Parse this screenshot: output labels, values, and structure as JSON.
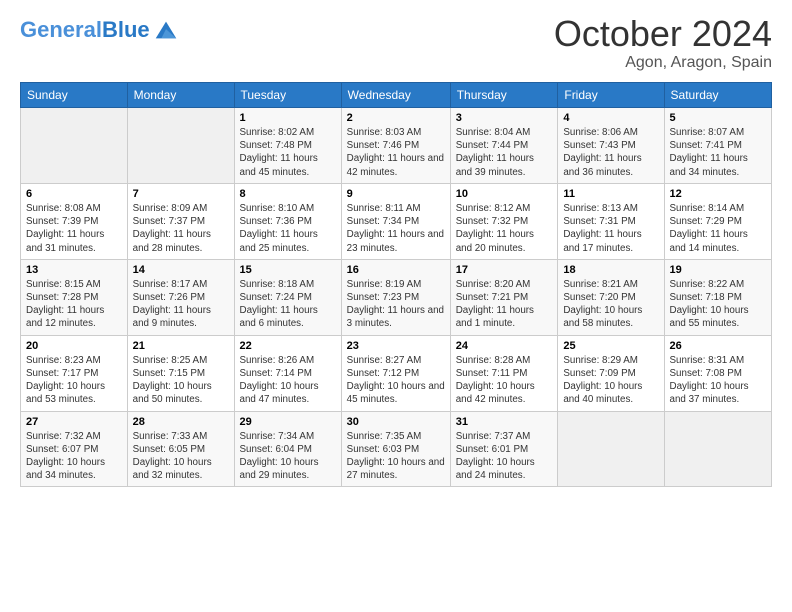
{
  "header": {
    "logo_general": "General",
    "logo_blue": "Blue",
    "month": "October 2024",
    "location": "Agon, Aragon, Spain"
  },
  "weekdays": [
    "Sunday",
    "Monday",
    "Tuesday",
    "Wednesday",
    "Thursday",
    "Friday",
    "Saturday"
  ],
  "weeks": [
    [
      {
        "day": "",
        "sunrise": "",
        "sunset": "",
        "daylight": ""
      },
      {
        "day": "",
        "sunrise": "",
        "sunset": "",
        "daylight": ""
      },
      {
        "day": "1",
        "sunrise": "Sunrise: 8:02 AM",
        "sunset": "Sunset: 7:48 PM",
        "daylight": "Daylight: 11 hours and 45 minutes."
      },
      {
        "day": "2",
        "sunrise": "Sunrise: 8:03 AM",
        "sunset": "Sunset: 7:46 PM",
        "daylight": "Daylight: 11 hours and 42 minutes."
      },
      {
        "day": "3",
        "sunrise": "Sunrise: 8:04 AM",
        "sunset": "Sunset: 7:44 PM",
        "daylight": "Daylight: 11 hours and 39 minutes."
      },
      {
        "day": "4",
        "sunrise": "Sunrise: 8:06 AM",
        "sunset": "Sunset: 7:43 PM",
        "daylight": "Daylight: 11 hours and 36 minutes."
      },
      {
        "day": "5",
        "sunrise": "Sunrise: 8:07 AM",
        "sunset": "Sunset: 7:41 PM",
        "daylight": "Daylight: 11 hours and 34 minutes."
      }
    ],
    [
      {
        "day": "6",
        "sunrise": "Sunrise: 8:08 AM",
        "sunset": "Sunset: 7:39 PM",
        "daylight": "Daylight: 11 hours and 31 minutes."
      },
      {
        "day": "7",
        "sunrise": "Sunrise: 8:09 AM",
        "sunset": "Sunset: 7:37 PM",
        "daylight": "Daylight: 11 hours and 28 minutes."
      },
      {
        "day": "8",
        "sunrise": "Sunrise: 8:10 AM",
        "sunset": "Sunset: 7:36 PM",
        "daylight": "Daylight: 11 hours and 25 minutes."
      },
      {
        "day": "9",
        "sunrise": "Sunrise: 8:11 AM",
        "sunset": "Sunset: 7:34 PM",
        "daylight": "Daylight: 11 hours and 23 minutes."
      },
      {
        "day": "10",
        "sunrise": "Sunrise: 8:12 AM",
        "sunset": "Sunset: 7:32 PM",
        "daylight": "Daylight: 11 hours and 20 minutes."
      },
      {
        "day": "11",
        "sunrise": "Sunrise: 8:13 AM",
        "sunset": "Sunset: 7:31 PM",
        "daylight": "Daylight: 11 hours and 17 minutes."
      },
      {
        "day": "12",
        "sunrise": "Sunrise: 8:14 AM",
        "sunset": "Sunset: 7:29 PM",
        "daylight": "Daylight: 11 hours and 14 minutes."
      }
    ],
    [
      {
        "day": "13",
        "sunrise": "Sunrise: 8:15 AM",
        "sunset": "Sunset: 7:28 PM",
        "daylight": "Daylight: 11 hours and 12 minutes."
      },
      {
        "day": "14",
        "sunrise": "Sunrise: 8:17 AM",
        "sunset": "Sunset: 7:26 PM",
        "daylight": "Daylight: 11 hours and 9 minutes."
      },
      {
        "day": "15",
        "sunrise": "Sunrise: 8:18 AM",
        "sunset": "Sunset: 7:24 PM",
        "daylight": "Daylight: 11 hours and 6 minutes."
      },
      {
        "day": "16",
        "sunrise": "Sunrise: 8:19 AM",
        "sunset": "Sunset: 7:23 PM",
        "daylight": "Daylight: 11 hours and 3 minutes."
      },
      {
        "day": "17",
        "sunrise": "Sunrise: 8:20 AM",
        "sunset": "Sunset: 7:21 PM",
        "daylight": "Daylight: 11 hours and 1 minute."
      },
      {
        "day": "18",
        "sunrise": "Sunrise: 8:21 AM",
        "sunset": "Sunset: 7:20 PM",
        "daylight": "Daylight: 10 hours and 58 minutes."
      },
      {
        "day": "19",
        "sunrise": "Sunrise: 8:22 AM",
        "sunset": "Sunset: 7:18 PM",
        "daylight": "Daylight: 10 hours and 55 minutes."
      }
    ],
    [
      {
        "day": "20",
        "sunrise": "Sunrise: 8:23 AM",
        "sunset": "Sunset: 7:17 PM",
        "daylight": "Daylight: 10 hours and 53 minutes."
      },
      {
        "day": "21",
        "sunrise": "Sunrise: 8:25 AM",
        "sunset": "Sunset: 7:15 PM",
        "daylight": "Daylight: 10 hours and 50 minutes."
      },
      {
        "day": "22",
        "sunrise": "Sunrise: 8:26 AM",
        "sunset": "Sunset: 7:14 PM",
        "daylight": "Daylight: 10 hours and 47 minutes."
      },
      {
        "day": "23",
        "sunrise": "Sunrise: 8:27 AM",
        "sunset": "Sunset: 7:12 PM",
        "daylight": "Daylight: 10 hours and 45 minutes."
      },
      {
        "day": "24",
        "sunrise": "Sunrise: 8:28 AM",
        "sunset": "Sunset: 7:11 PM",
        "daylight": "Daylight: 10 hours and 42 minutes."
      },
      {
        "day": "25",
        "sunrise": "Sunrise: 8:29 AM",
        "sunset": "Sunset: 7:09 PM",
        "daylight": "Daylight: 10 hours and 40 minutes."
      },
      {
        "day": "26",
        "sunrise": "Sunrise: 8:31 AM",
        "sunset": "Sunset: 7:08 PM",
        "daylight": "Daylight: 10 hours and 37 minutes."
      }
    ],
    [
      {
        "day": "27",
        "sunrise": "Sunrise: 7:32 AM",
        "sunset": "Sunset: 6:07 PM",
        "daylight": "Daylight: 10 hours and 34 minutes."
      },
      {
        "day": "28",
        "sunrise": "Sunrise: 7:33 AM",
        "sunset": "Sunset: 6:05 PM",
        "daylight": "Daylight: 10 hours and 32 minutes."
      },
      {
        "day": "29",
        "sunrise": "Sunrise: 7:34 AM",
        "sunset": "Sunset: 6:04 PM",
        "daylight": "Daylight: 10 hours and 29 minutes."
      },
      {
        "day": "30",
        "sunrise": "Sunrise: 7:35 AM",
        "sunset": "Sunset: 6:03 PM",
        "daylight": "Daylight: 10 hours and 27 minutes."
      },
      {
        "day": "31",
        "sunrise": "Sunrise: 7:37 AM",
        "sunset": "Sunset: 6:01 PM",
        "daylight": "Daylight: 10 hours and 24 minutes."
      },
      {
        "day": "",
        "sunrise": "",
        "sunset": "",
        "daylight": ""
      },
      {
        "day": "",
        "sunrise": "",
        "sunset": "",
        "daylight": ""
      }
    ]
  ]
}
